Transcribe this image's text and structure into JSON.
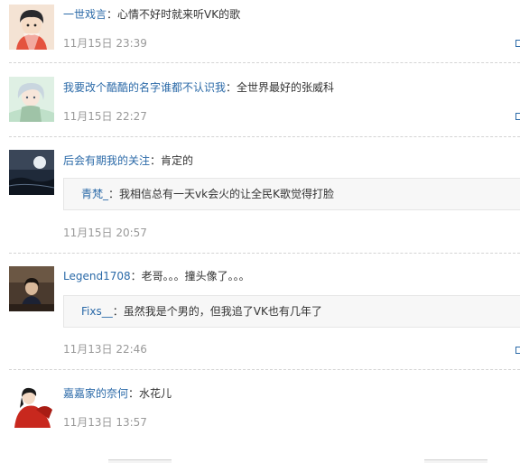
{
  "comments": [
    {
      "user": "一世戏言",
      "text": "心情不好时就来听VK的歌",
      "time": "11月15日 23:39"
    },
    {
      "user": "我要改个酷酷的名字谁都不认识我",
      "text": "全世界最好的张威科",
      "time": "11月15日 22:27"
    },
    {
      "user": "后会有期我的关注",
      "text": "肯定的",
      "time": "11月15日 20:57",
      "reply": {
        "user": "青梵_",
        "text": "我相信总有一天vk会火的让全民K歌觉得打脸"
      }
    },
    {
      "user": "Legend1708",
      "text": "老哥。。。撞头像了。。。",
      "time": "11月13日 22:46",
      "reply": {
        "user": "Fixs__",
        "text": "虽然我是个男的，但我追了VK也有几年了"
      }
    },
    {
      "user": "嘉嘉家的奈何",
      "text": "水花儿",
      "time": "11月13日 13:57"
    }
  ],
  "colon": "：",
  "colors": {
    "link": "#2b6aa8",
    "time": "#999999",
    "text": "#333333",
    "reply_bg": "#f7f7f7"
  },
  "icons": [
    "reply-icon"
  ]
}
